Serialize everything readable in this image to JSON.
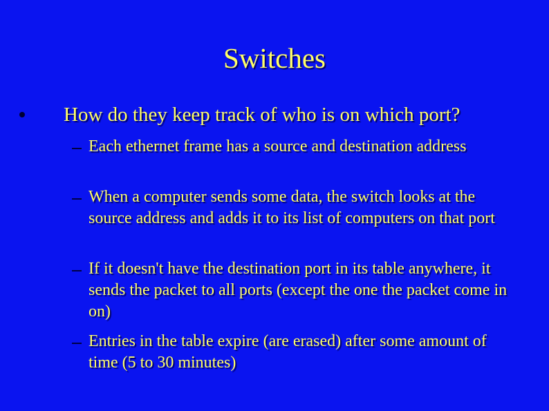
{
  "slide": {
    "title": "Switches",
    "bullet": {
      "text": "How do they keep track of who is on which port?",
      "sub_bullets": [
        "Each ethernet frame has a source and destination address",
        "When a computer sends some data, the switch looks at the source address and adds it to its list of computers on that port",
        "If it doesn't have the destination port in its table anywhere, it sends the packet to all ports (except the one the packet come in on)",
        "Entries in the table expire (are erased) after some amount of time (5 to 30 minutes)"
      ]
    }
  },
  "colors": {
    "background": "#0a14f0",
    "text": "#ffff66"
  }
}
